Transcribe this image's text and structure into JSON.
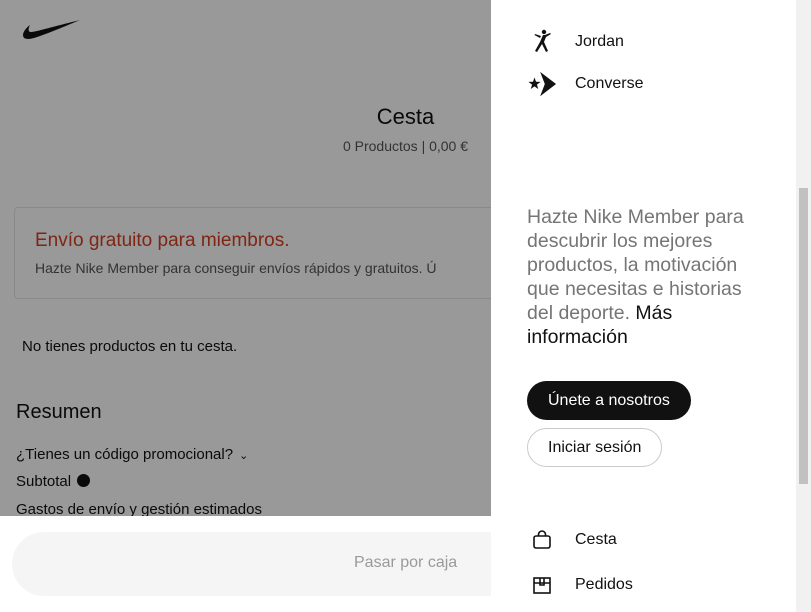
{
  "background": {
    "cart_title": "Cesta",
    "cart_subtitle": "0 Productos | 0,00 €",
    "promo_title": "Envío gratuito para miembros.",
    "promo_text": "Hazte Nike Member para conseguir envíos rápidos y gratuitos. Ú",
    "empty_text": "No tienes productos en tu cesta.",
    "summary_title": "Resumen",
    "promo_code": "¿Tienes un código promocional?",
    "subtotal": "Subtotal",
    "shipping": "Gastos de envío y gestión estimados",
    "checkout_label": "Pasar por caja"
  },
  "menu": {
    "brands": [
      {
        "label": "Jordan",
        "icon": "jordan-jumpman-icon"
      },
      {
        "label": "Converse",
        "icon": "converse-star-chevron-icon"
      }
    ],
    "member_text": "Hazte Nike Member para descubrir los mejores productos, la motivación que necesitas e historias del deporte.",
    "member_more": "Más información",
    "join_label": "Únete a nosotros",
    "login_label": "Iniciar sesión",
    "links": [
      {
        "label": "Cesta",
        "icon": "bag-icon"
      },
      {
        "label": "Pedidos",
        "icon": "box-icon"
      }
    ]
  }
}
